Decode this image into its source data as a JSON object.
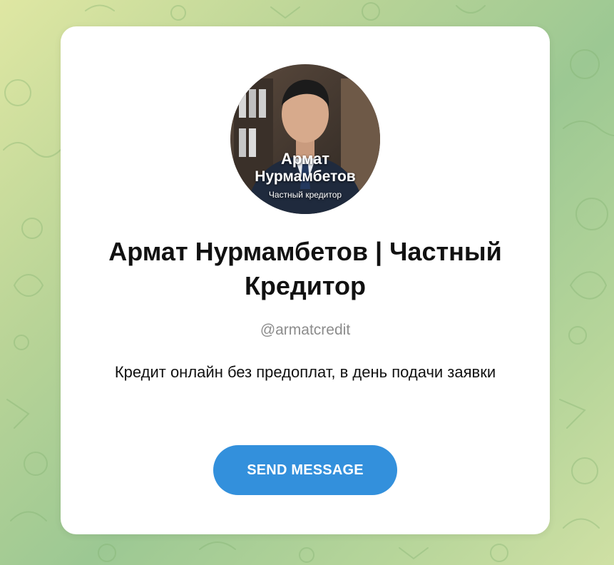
{
  "background": {
    "pattern": "doodle-cats-pattern",
    "gradient_colors": [
      "#dfe7a3",
      "#9cc893",
      "#cfe0a4"
    ]
  },
  "profile": {
    "avatar": {
      "icon": "profile-photo",
      "first_name": "Армат",
      "last_name": "Нурмамбетов",
      "role": "Частный кредитор"
    },
    "display_name": "Армат Нурмамбетов | Частный Кредитор",
    "username": "@armatcredit",
    "description": "Кредит онлайн без предоплат, в день подачи заявки"
  },
  "actions": {
    "send_label": "SEND MESSAGE",
    "accent_color": "#3390dc"
  }
}
